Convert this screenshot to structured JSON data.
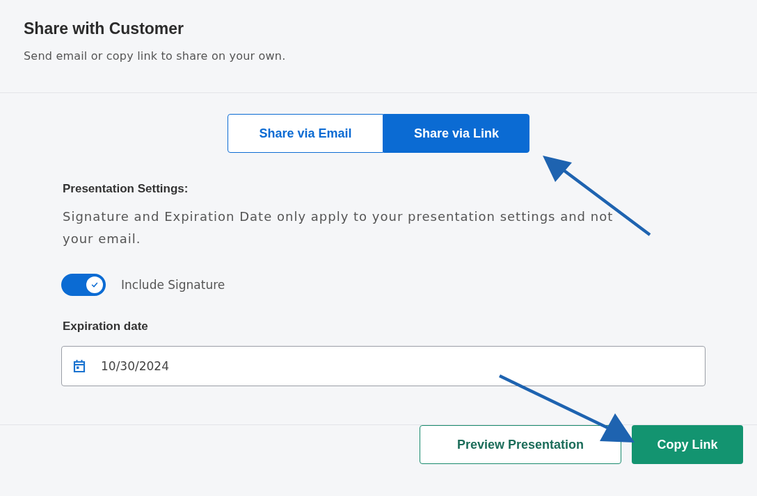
{
  "dialog": {
    "title": "Share with Customer",
    "subtitle": "Send email or copy link to share on your own."
  },
  "share_tabs": [
    {
      "label": "Share via Email",
      "selected": false
    },
    {
      "label": "Share via Link",
      "selected": true
    }
  ],
  "settings": {
    "heading": "Presentation Settings:",
    "note": "Signature and Expiration Date only apply to your presentation settings and not your email.",
    "toggle": {
      "label": "Include Signature",
      "on": true
    }
  },
  "expiration": {
    "label": "Expiration date",
    "value": "10/30/2024"
  },
  "buttons": [
    {
      "label": "Preview Presentation",
      "kind": "secondary"
    },
    {
      "label": "Copy Link",
      "kind": "primary"
    }
  ]
}
